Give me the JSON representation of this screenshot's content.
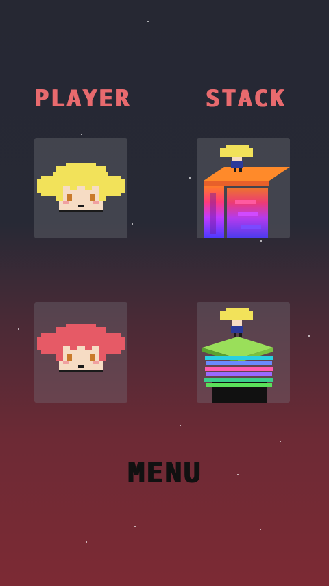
{
  "headers": {
    "player": "PLAYER",
    "stack": "STACK"
  },
  "menu": {
    "label": "MENU"
  },
  "tiles": {
    "player_1": {
      "icon": "blonde-pigtails-character-face",
      "selected": true
    },
    "player_2": {
      "icon": "red-pigtails-character-face",
      "selected": false
    },
    "stack_1": {
      "icon": "rainbow-zigzag-stack",
      "selected": true
    },
    "stack_2": {
      "icon": "layered-plate-stack",
      "selected": false
    }
  },
  "colors": {
    "title": "#e86a6e",
    "menu": "#111111",
    "blonde_hair": "#f2e25a",
    "red_hair": "#e65a66",
    "skin": "#f6dcc4"
  }
}
